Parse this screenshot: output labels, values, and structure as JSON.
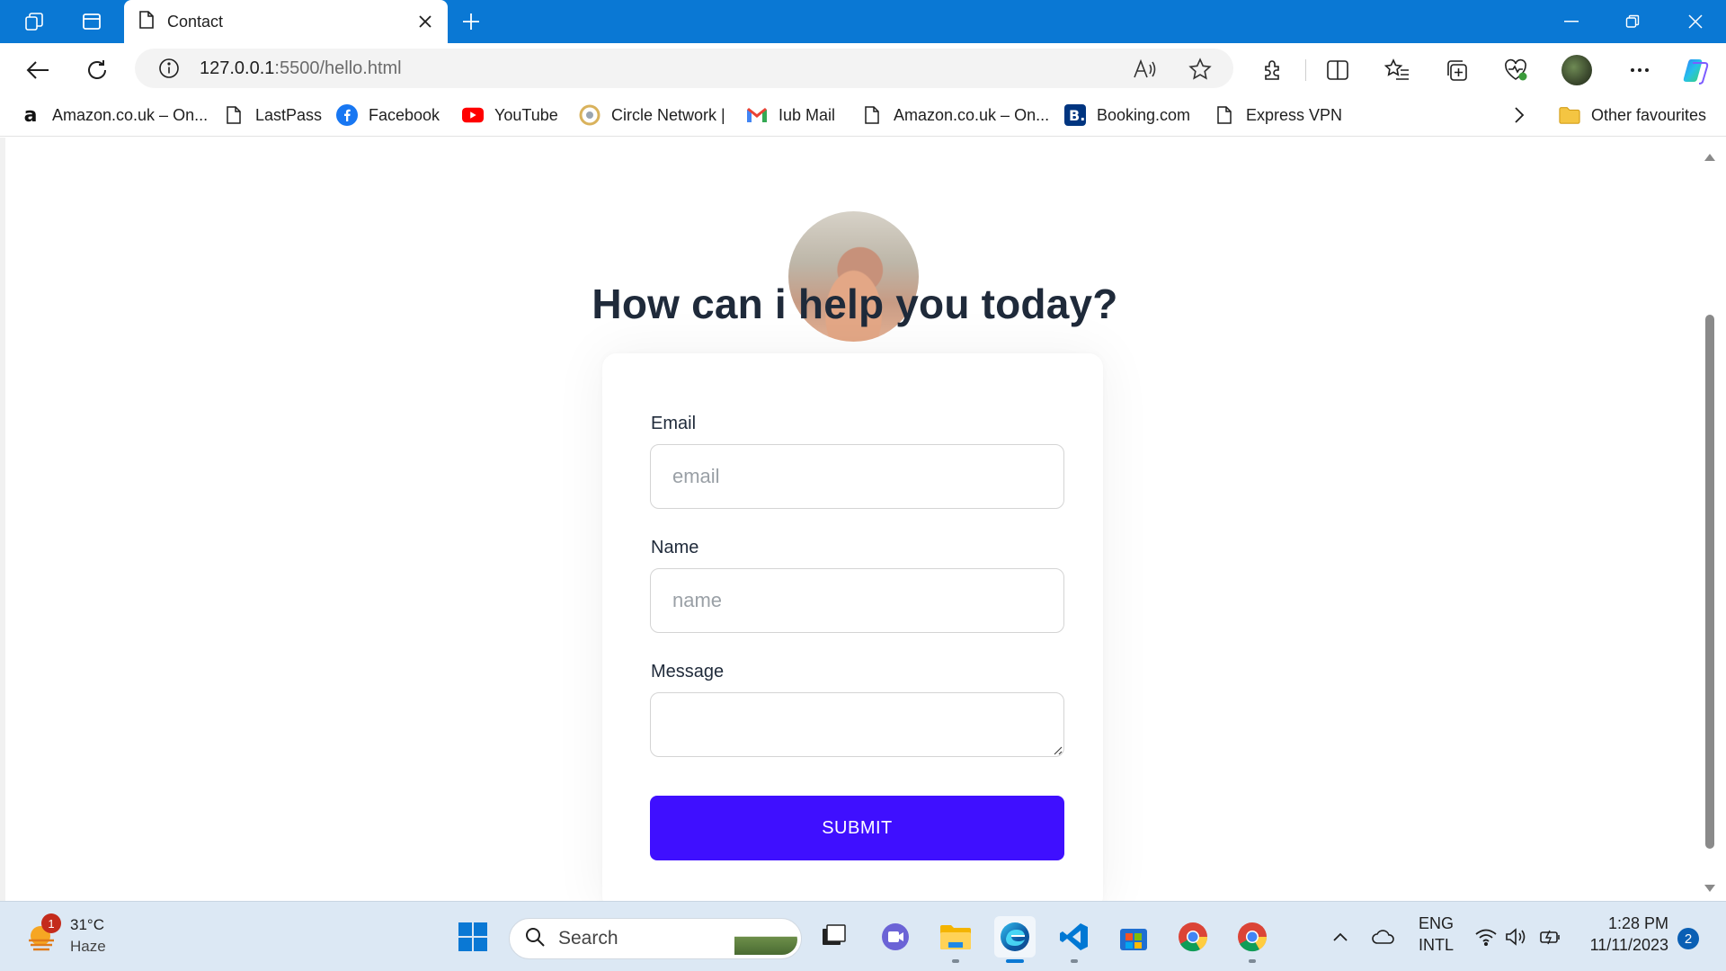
{
  "browser": {
    "tab": {
      "title": "Contact"
    },
    "address": {
      "url_host": "127.0.0.1",
      "url_rest": ":5500/hello.html"
    },
    "favourites": [
      {
        "label": "Amazon.co.uk – On...",
        "icon": "amazon-icon"
      },
      {
        "label": "LastPass",
        "icon": "page-icon"
      },
      {
        "label": "Facebook",
        "icon": "facebook-icon"
      },
      {
        "label": "YouTube",
        "icon": "youtube-icon"
      },
      {
        "label": "Circle Network |",
        "icon": "circle-network-icon"
      },
      {
        "label": "Iub Mail",
        "icon": "gmail-icon"
      },
      {
        "label": "Amazon.co.uk – On...",
        "icon": "page-icon"
      },
      {
        "label": "Booking.com",
        "icon": "booking-icon"
      },
      {
        "label": "Express VPN",
        "icon": "page-icon"
      }
    ],
    "other_favourites": "Other favourites"
  },
  "page": {
    "heading": "How can i help you today?",
    "form": {
      "email_label": "Email",
      "email_placeholder": "email",
      "name_label": "Name",
      "name_placeholder": "name",
      "message_label": "Message",
      "submit_label": "SUBMIT"
    },
    "colors": {
      "submit_bg": "#3f0fff",
      "heading": "#1f2a3a"
    }
  },
  "taskbar": {
    "weather": {
      "temp": "31°C",
      "condition": "Haze",
      "badge": "1"
    },
    "search_label": "Search",
    "language": {
      "lang": "ENG",
      "layout": "INTL"
    },
    "clock": {
      "time": "1:28 PM",
      "date": "11/11/2023"
    },
    "notifications": "2"
  }
}
